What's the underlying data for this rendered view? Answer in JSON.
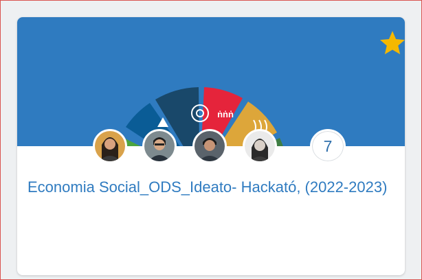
{
  "card": {
    "title": "Economia Social_ODS_Ideato- Hackató, (2022-2023)",
    "member_count": "7",
    "favorite": true,
    "banner_color": "#2f7bc0",
    "star_color": "#f5b800",
    "avatars": [
      "member-1",
      "member-2",
      "member-3",
      "member-4"
    ],
    "icons": [
      "star-icon"
    ]
  }
}
